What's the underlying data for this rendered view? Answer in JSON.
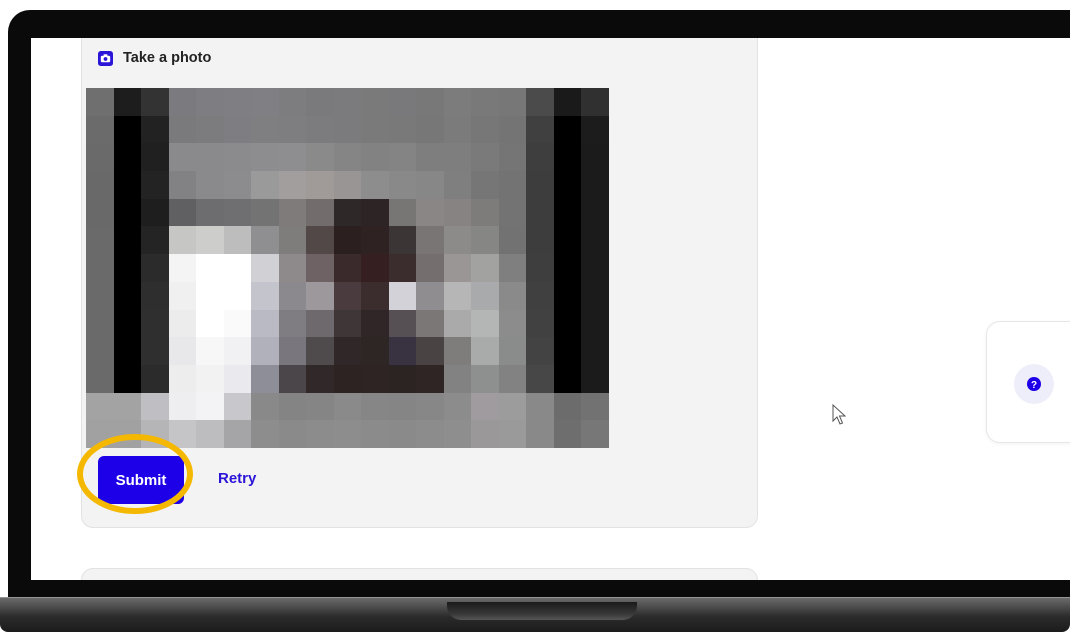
{
  "card": {
    "title": "Take a photo",
    "title_icon": "camera-icon",
    "submit_label": "Submit",
    "retry_label": "Retry"
  },
  "help_widget": {
    "icon": "question-icon"
  },
  "colors": {
    "accent": "#1e00e8",
    "link": "#2a14d8",
    "highlight": "#f5b800",
    "card_bg": "#f3f3f3"
  },
  "photo_pixels": [
    [
      "#6f6f6f",
      "#1d1d1d",
      "#333333",
      "#7b7b7f",
      "#7e7e82",
      "#7f7f83",
      "#808084",
      "#7d7d80",
      "#7a7a7c",
      "#7b7b7d",
      "#7a7a7b",
      "#79797b",
      "#787879",
      "#7c7c7d",
      "#79797a",
      "#777777",
      "#4b4b4b",
      "#1a1a1a",
      "#303030"
    ],
    [
      "#6b6b6b",
      "#000000",
      "#222222",
      "#7a7a7d",
      "#7c7c7f",
      "#7e7e82",
      "#7f7f82",
      "#7e7e80",
      "#7c7c7e",
      "#7b7b7d",
      "#7a7a7b",
      "#79797a",
      "#777778",
      "#7b7b7b",
      "#777777",
      "#747474",
      "#404040",
      "#000000",
      "#1c1c1c"
    ],
    [
      "#6a6a6a",
      "#000000",
      "#202020",
      "#8a8a8d",
      "#8a8a8c",
      "#8b8b8d",
      "#8d8d8f",
      "#8e8e90",
      "#8a8a8b",
      "#858586",
      "#828282",
      "#848484",
      "#7e7e7e",
      "#7e7e7e",
      "#7a7a7a",
      "#757575",
      "#3e3e3e",
      "#000000",
      "#1b1b1b"
    ],
    [
      "#696969",
      "#000000",
      "#232323",
      "#828284",
      "#8a8a8c",
      "#8c8c8e",
      "#9a9a9b",
      "#a19e9d",
      "#a09a98",
      "#999595",
      "#8d8d8d",
      "#8a8989",
      "#878787",
      "#7f7f7f",
      "#767676",
      "#737373",
      "#3d3d3d",
      "#000000",
      "#1b1b1b"
    ],
    [
      "#696969",
      "#000000",
      "#1e1e1e",
      "#606062",
      "#6d6d6f",
      "#6f6f71",
      "#737374",
      "#7f7b7b",
      "#736c6c",
      "#2e2828",
      "#2d2525",
      "#787575",
      "#8a8686",
      "#868382",
      "#7e7c7b",
      "#737373",
      "#3d3d3d",
      "#000000",
      "#1b1b1b"
    ],
    [
      "#6a6a6a",
      "#000000",
      "#242424",
      "#c6c6c4",
      "#cdcdcb",
      "#bdbdbd",
      "#8f8f91",
      "#7f7c7c",
      "#524848",
      "#2c1f1f",
      "#2e2222",
      "#3b3535",
      "#7a7575",
      "#8d8b8a",
      "#868685",
      "#727272",
      "#3d3d3d",
      "#000000",
      "#1b1b1b"
    ],
    [
      "#6a6a6a",
      "#000000",
      "#2b2b2b",
      "#f4f4f4",
      "#ffffff",
      "#ffffff",
      "#d1d1d5",
      "#8e8a8c",
      "#6e6264",
      "#3b2a2b",
      "#351f21",
      "#3b2d2e",
      "#756e6f",
      "#999695",
      "#a2a2a1",
      "#7f7f7f",
      "#3e3e3e",
      "#000000",
      "#1b1b1b"
    ],
    [
      "#6a6a6a",
      "#000000",
      "#2e2e2e",
      "#f0f0f0",
      "#ffffff",
      "#ffffff",
      "#c4c4cc",
      "#8b898d",
      "#9d989b",
      "#4a3c3e",
      "#3b2c2e",
      "#d2d2d8",
      "#8f8d8f",
      "#b6b6b6",
      "#a8aaab",
      "#8a8a8a",
      "#404040",
      "#000000",
      "#1b1b1b"
    ],
    [
      "#6a6a6a",
      "#000000",
      "#2f2f2f",
      "#ececec",
      "#ffffff",
      "#fafafa",
      "#babac4",
      "#7f7c82",
      "#6e696c",
      "#3f3638",
      "#302527",
      "#565055",
      "#7a7776",
      "#abaaaa",
      "#b4b6b6",
      "#8c8c8c",
      "#414141",
      "#000000",
      "#1b1b1b"
    ],
    [
      "#6a6a6a",
      "#000000",
      "#2f2f2f",
      "#e8e8ea",
      "#f7f7f7",
      "#f1f1f3",
      "#b1b1bc",
      "#79777d",
      "#4f4a4c",
      "#302828",
      "#2e2525",
      "#393341",
      "#4a4344",
      "#7f7c7c",
      "#a9abab",
      "#8a8b8b",
      "#434343",
      "#000000",
      "#1b1b1b"
    ],
    [
      "#6a6a6a",
      "#000000",
      "#2b2b2b",
      "#ededed",
      "#f2f2f2",
      "#eaeaee",
      "#8e8e99",
      "#4b4649",
      "#302829",
      "#2d2323",
      "#2e2424",
      "#2c2323",
      "#2f2525",
      "#838283",
      "#8e9090",
      "#828282",
      "#474747",
      "#000000",
      "#1b1b1b"
    ],
    [
      "#a3a3a3",
      "#a3a3a3",
      "#bfbfc3",
      "#eeeef0",
      "#f3f3f5",
      "#c8c8cc",
      "#898989",
      "#848484",
      "#858585",
      "#8a8a8a",
      "#868686",
      "#858585",
      "#878787",
      "#8d8c8d",
      "#a09b9e",
      "#9c9c9c",
      "#898989",
      "#6c6c6c",
      "#727272"
    ],
    [
      "#a1a1a1",
      "#a1a1a1",
      "#b5b5b7",
      "#c5c5c7",
      "#bdbdbf",
      "#a5a5a8",
      "#8d8d8d",
      "#8a8a8a",
      "#8c8c8c",
      "#8d8d8d",
      "#8b8b8b",
      "#8a8a8a",
      "#8c8c8c",
      "#8f8e8f",
      "#9b9899",
      "#9a9a9a",
      "#898989",
      "#6e6e6e",
      "#777777"
    ]
  ]
}
